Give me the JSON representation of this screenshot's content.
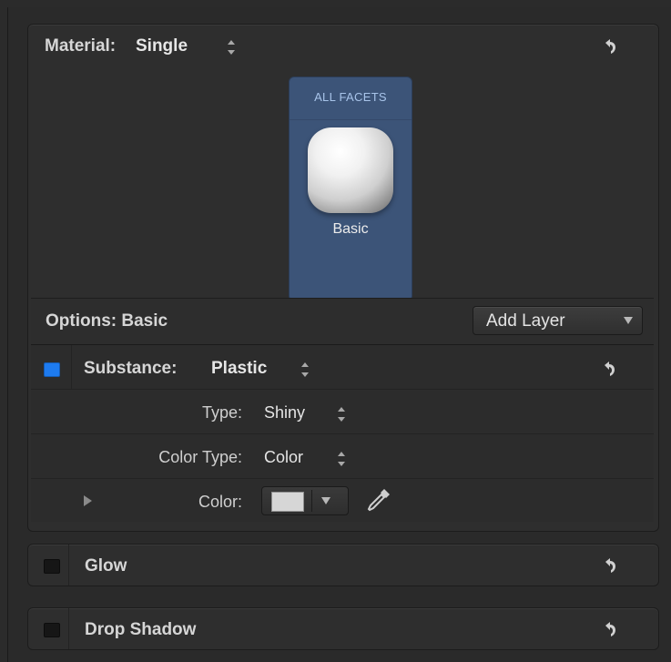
{
  "material": {
    "label": "Material:",
    "value": "Single",
    "tile": {
      "title": "ALL FACETS",
      "name": "Basic",
      "accent": "#3c5478"
    }
  },
  "options": {
    "label": "Options: Basic",
    "add_layer": "Add Layer"
  },
  "substance": {
    "label": "Substance:",
    "value": "Plastic",
    "enabled_color": "#1e7bef",
    "type_label": "Type:",
    "type_value": "Shiny",
    "color_type_label": "Color Type:",
    "color_type_value": "Color",
    "color_label": "Color:",
    "color_swatch": "#d6d6d6"
  },
  "glow": {
    "label": "Glow"
  },
  "drop_shadow": {
    "label": "Drop Shadow"
  },
  "icons": {
    "reset": "reset-arrow-icon",
    "stepper": "up-down-stepper-icon",
    "eyedropper": "eyedropper-icon",
    "disclosure": "disclosure-triangle-icon"
  }
}
